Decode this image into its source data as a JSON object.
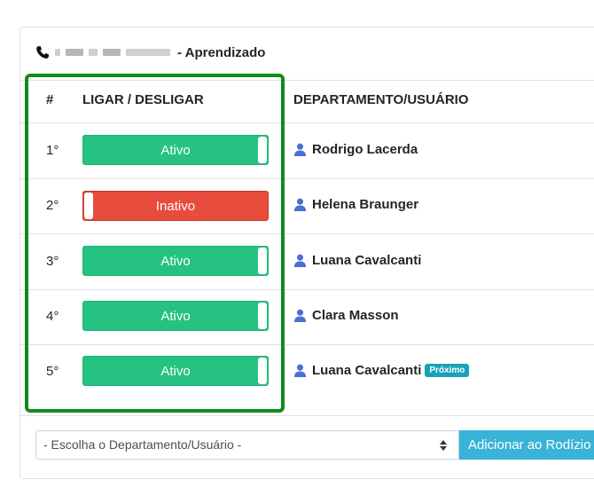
{
  "header": {
    "phone_icon": "phone-icon",
    "title_suffix": "- Aprendizado"
  },
  "table": {
    "col_num": "#",
    "col_toggle": "LIGAR / DESLIGAR",
    "col_user": "DEPARTAMENTO/USUÁRIO",
    "rows": [
      {
        "pos": "1°",
        "status": "Ativo",
        "state": "on",
        "user": "Rodrigo Lacerda",
        "badge": ""
      },
      {
        "pos": "2°",
        "status": "Inativo",
        "state": "off",
        "user": "Helena Braunger",
        "badge": ""
      },
      {
        "pos": "3°",
        "status": "Ativo",
        "state": "on",
        "user": "Luana Cavalcanti",
        "badge": ""
      },
      {
        "pos": "4°",
        "status": "Ativo",
        "state": "on",
        "user": "Clara Masson",
        "badge": ""
      },
      {
        "pos": "5°",
        "status": "Ativo",
        "state": "on",
        "user": "Luana Cavalcanti",
        "badge": "Próximo"
      }
    ]
  },
  "footer": {
    "select_value": "- Escolha o Departamento/Usuário -",
    "add_button": "Adicionar ao Rodízio"
  },
  "colors": {
    "active": "#26c281",
    "inactive": "#e74c3c",
    "highlight": "#138a1c",
    "user_icon": "#4a6fd6",
    "badge": "#17a2b8",
    "add_button": "#39b3d7"
  }
}
